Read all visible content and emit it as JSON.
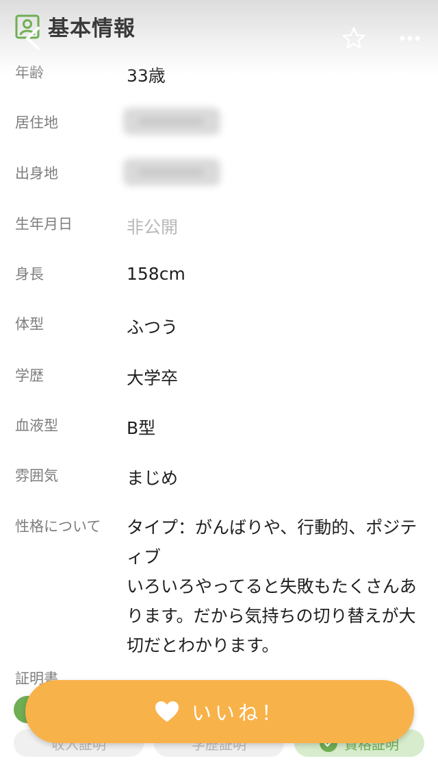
{
  "header": {
    "section_title": "基本情報",
    "section_icon": "person-card-icon",
    "back_icon": "chevron-left-icon",
    "favorite_icon": "star-outline-icon",
    "more_icon": "ellipsis-icon"
  },
  "profile": {
    "age": {
      "label": "年齢",
      "value": "33歳"
    },
    "residence": {
      "label": "居住地",
      "value_state": "blurred"
    },
    "hometown": {
      "label": "出身地",
      "value_state": "blurred"
    },
    "birthday": {
      "label": "生年月日",
      "value": "非公開"
    },
    "height": {
      "label": "身長",
      "value": "158cm"
    },
    "body_type": {
      "label": "体型",
      "value": "ふつう"
    },
    "education": {
      "label": "学歴",
      "value": "大学卒"
    },
    "blood_type": {
      "label": "血液型",
      "value": "B型"
    },
    "atmosphere": {
      "label": "雰囲気",
      "value": "まじめ"
    },
    "personality": {
      "label": "性格について",
      "value": "タイプ：がんばりや、行動的、ポジティブ\nいろいろやってると失敗もたくさんあります。だから気持ちの切り替えが大切だとわかります。"
    }
  },
  "certificates": {
    "label": "証明書",
    "items": [
      {
        "label": "収入証明",
        "verified": false
      },
      {
        "label": "学歴証明",
        "verified": false
      },
      {
        "label": "資格証明",
        "verified": true
      }
    ]
  },
  "like_button": {
    "label": "いいね！",
    "icon": "heart-icon",
    "color": "#f8b24a"
  },
  "colors": {
    "accent_green": "#6fae54",
    "label_gray": "#7d7d7d",
    "muted_gray": "#b8b8b8"
  }
}
